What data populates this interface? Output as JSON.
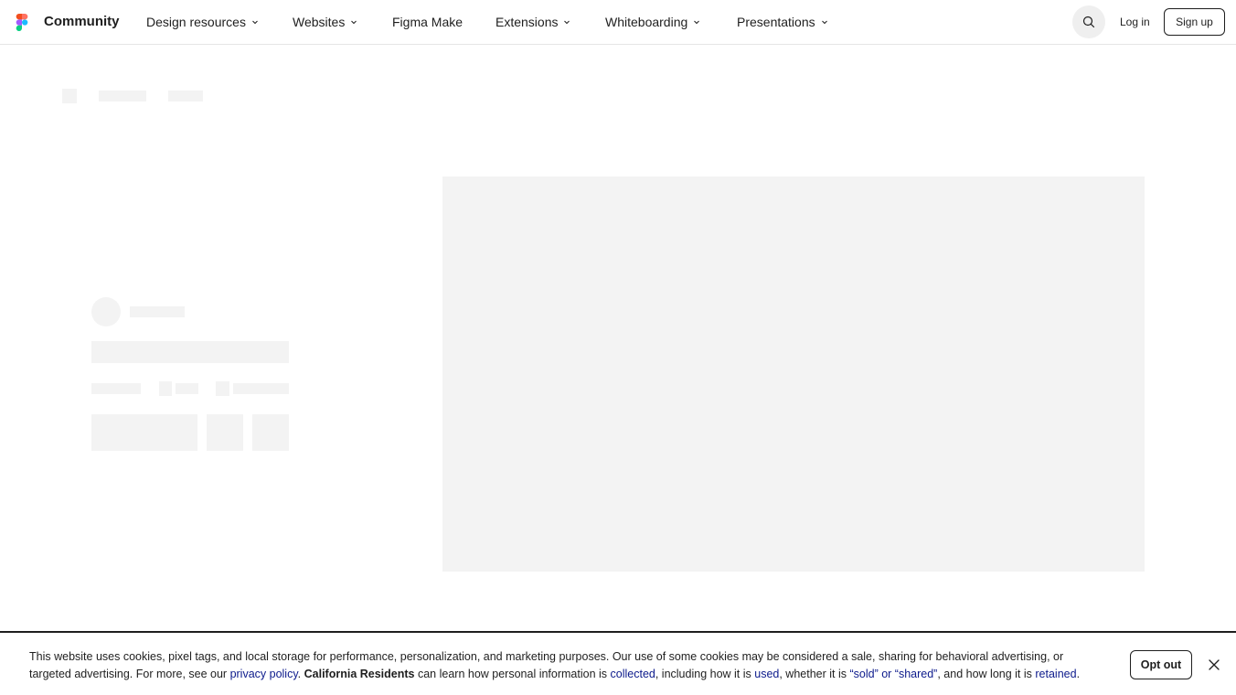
{
  "header": {
    "brand": "Community",
    "nav": [
      {
        "label": "Design resources",
        "has_dropdown": true
      },
      {
        "label": "Websites",
        "has_dropdown": true
      },
      {
        "label": "Figma Make",
        "has_dropdown": false
      },
      {
        "label": "Extensions",
        "has_dropdown": true
      },
      {
        "label": "Whiteboarding",
        "has_dropdown": true
      },
      {
        "label": "Presentations",
        "has_dropdown": true
      }
    ],
    "search_icon": "search-icon",
    "login_label": "Log in",
    "signup_label": "Sign up"
  },
  "cookie_banner": {
    "text_part1": "This website uses cookies, pixel tags, and local storage for performance, personalization, and marketing purposes. Our use of some cookies may be considered a sale, sharing for behavioral advertising, or targeted advertising. For more, see our ",
    "privacy_link": "privacy policy",
    "text_part2": ". ",
    "california_bold": "California Residents",
    "text_part3": " can learn how personal information is ",
    "collected_link": "collected",
    "text_part4": ", including how it is ",
    "used_link": "used",
    "text_part5": ", whether it is ",
    "sold_link": "“sold” or “shared”",
    "text_part6": ", and how long it is ",
    "retained_link": "retained",
    "text_part7": ".",
    "optout_label": "Opt out",
    "close_icon": "close-icon"
  },
  "colors": {
    "skeleton": "#f3f3f3",
    "link": "#0d1b8c",
    "text": "#1e1e1e"
  }
}
